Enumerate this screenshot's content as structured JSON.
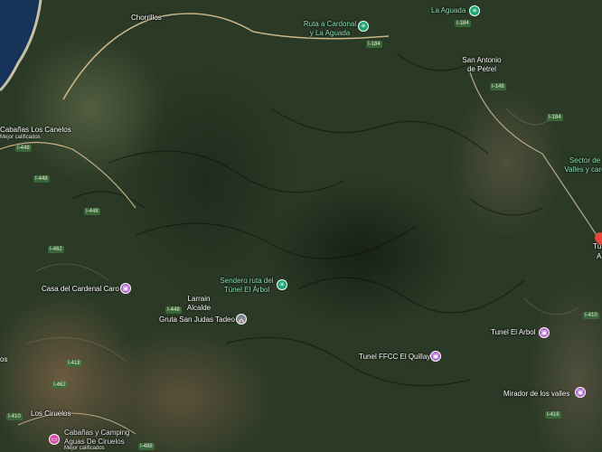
{
  "places": {
    "chorrillos": "Chorrillos",
    "san_antonio_line1": "San Antonio",
    "san_antonio_line2": "de Petrel",
    "cabanas_los_canelos": "Cabañas Los Canelos",
    "cabanas_sub": "Mejor calificados",
    "sector_line1": "Sector de",
    "sector_line2": "Valles y card",
    "larrain_line1": "Larrain",
    "larrain_line2": "Alcalde",
    "los_ciruelos": "Los Ciruelos",
    "edge_right": "Tú",
    "edge_right_2": "A",
    "edge_left": "os"
  },
  "pois": {
    "ruta_cardonal_line1": "Ruta a Cardonal",
    "ruta_cardonal_line2": "y La Aguada",
    "la_aguada": "La Aguada",
    "sendero_line1": "Sendero ruta del",
    "sendero_line2": "Túnel El Árbol",
    "casa_cardenal": "Casa del Cardenal Caro",
    "gruta": "Gruta San Judas Tadeo",
    "tunel_arbol": "Tunel El Arbol",
    "tunel_ffcc": "Tunel FFCC El Quillay",
    "mirador": "Mirador de los valles",
    "camping_line1": "Cabañas y Camping",
    "camping_line2": "Aguas De Ciruelos",
    "camping_sub": "Mejor calificados"
  },
  "roads": {
    "i184_a": "I-184",
    "i184_b": "I-184",
    "i184_c": "I-184",
    "i148": "I-148",
    "i448_a": "I-448",
    "i448_b": "I-448",
    "i448_c": "I-448",
    "i448_d": "I-448",
    "i462_a": "I-462",
    "i462_b": "I-462",
    "i418": "I-418",
    "i410_a": "I-410",
    "i410_b": "I-410",
    "i416": "I-416",
    "i488": "I-488"
  },
  "icons": {
    "hiking": "hiking-icon",
    "landmark": "landmark-icon",
    "church": "church-icon",
    "lodging": "lodging-icon",
    "viewpoint": "viewpoint-icon",
    "pin": "map-pin-icon"
  },
  "colors": {
    "poi_green": "#17a572",
    "poi_purple": "#b05fcf",
    "poi_pink": "#d34fa5",
    "pin_red": "#e5483a",
    "road_label": "#3c6e3c"
  }
}
